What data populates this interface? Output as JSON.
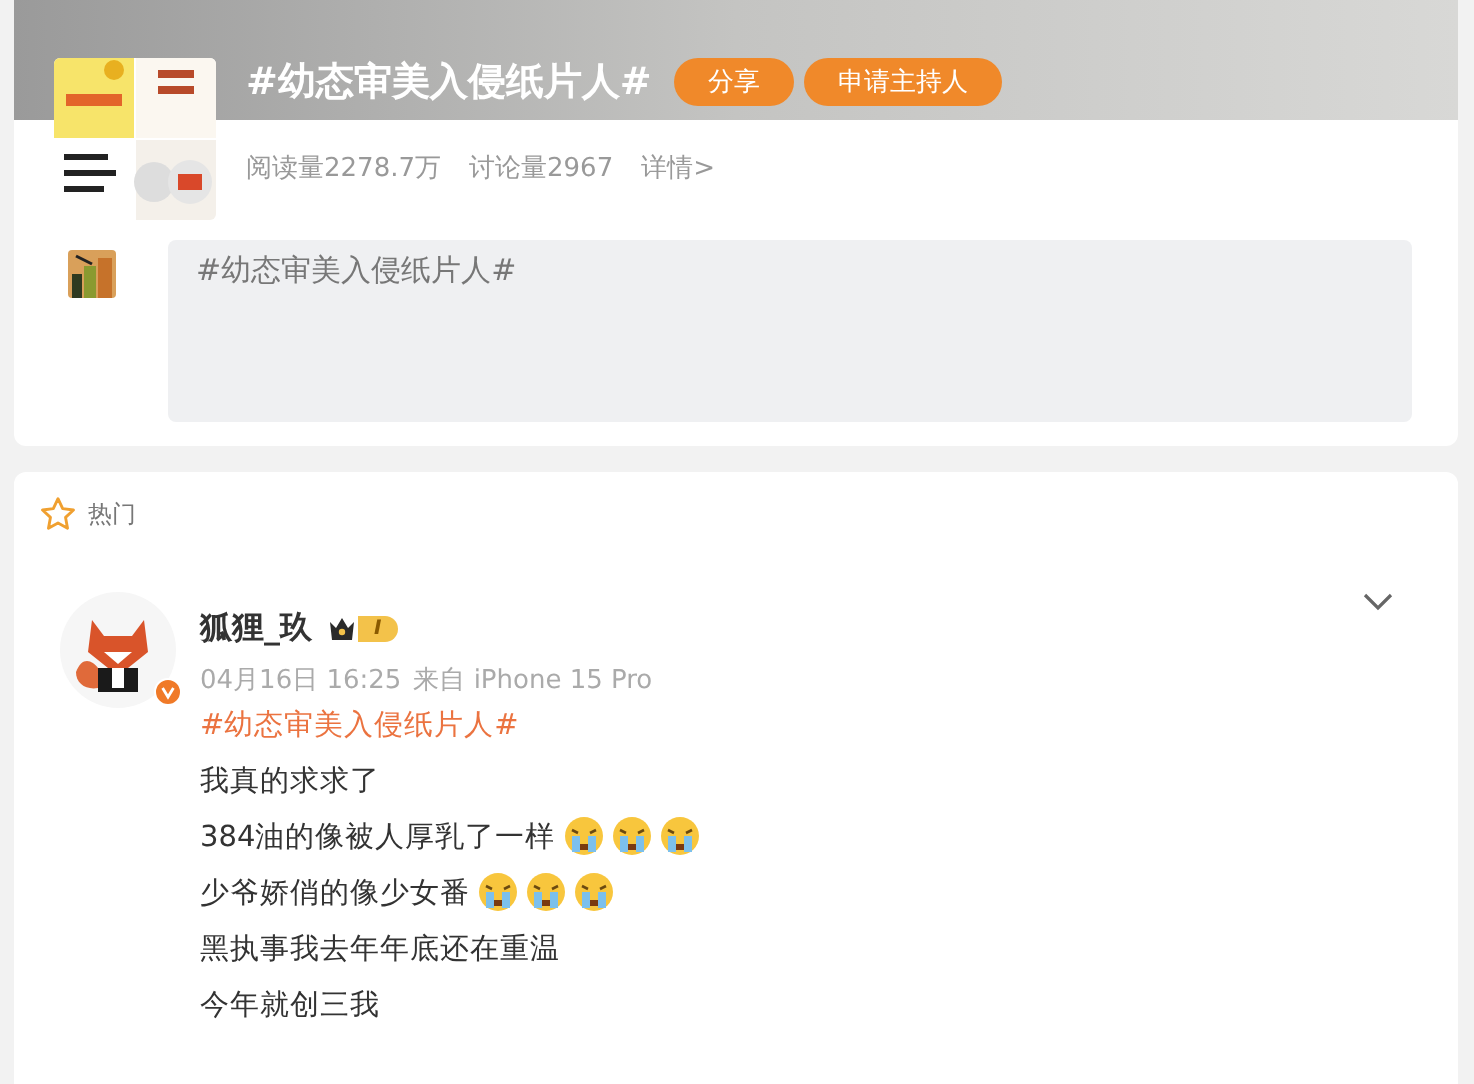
{
  "topic": {
    "title": "#幼态审美入侵纸片人#",
    "buttons": [
      "分享",
      "申请主持人"
    ],
    "stats": [
      "阅读量2278.7万",
      "讨论量2967"
    ],
    "details_link": "详情>"
  },
  "composer": {
    "value": "#幼态审美入侵纸片人#"
  },
  "feed": {
    "section_title": "热门",
    "posts": [
      {
        "author": "狐狸_玖",
        "verified": true,
        "rank": "I",
        "time": "04月16日 16:25",
        "source": "来自 iPhone 15 Pro",
        "hashtag": "#幼态审美入侵纸片人#",
        "lines": [
          {
            "text": "我真的求求了"
          },
          {
            "text": "384油的像被人厚乳了一样",
            "emojis": [
              {
                "kind": "cry"
              },
              {
                "kind": "cry"
              },
              {
                "kind": "cry"
              }
            ]
          },
          {
            "text": "少爷娇俏的像少女番",
            "emojis": [
              {
                "kind": "cry"
              },
              {
                "kind": "cry"
              },
              {
                "kind": "cry"
              }
            ]
          },
          {
            "text": "黑执事我去年年底还在重温"
          },
          {
            "text": "今年就创三我"
          }
        ]
      }
    ]
  }
}
